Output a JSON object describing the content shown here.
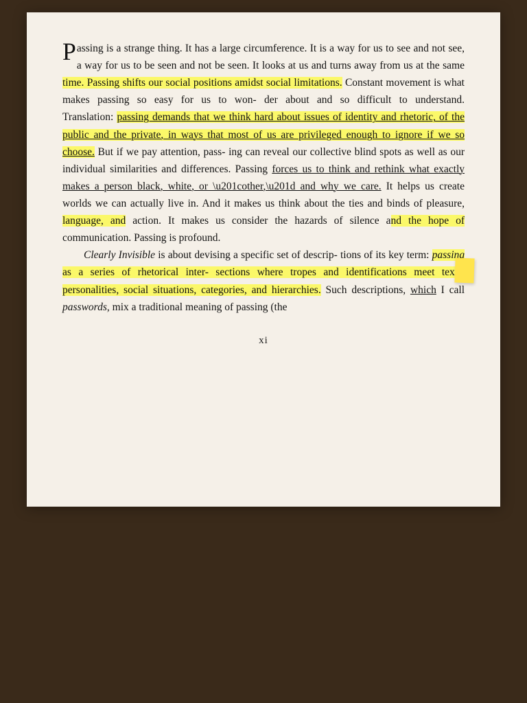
{
  "page": {
    "number": "xi",
    "background": "#f5f0e8"
  },
  "paragraphs": [
    {
      "id": "para1",
      "first_letter": "P",
      "text": "assing is a strange thing. It has a large circumference. It is a way for us to see and not see, a way for us to be seen and not be seen. It looks at us and turns away from us at the same time. Passing shifts our social positions amidst social limitations. Constant movement is what makes passing so easy for us to wonder about and so difficult to understand. Translation: passing demands that we think hard about issues of identity and rhetoric, of the public and the private, in ways that most of us are privileged enough to ignore if we so choose. But if we pay attention, passing can reveal our collective blind spots as well as our individual similarities and differences. Passing forces us to think and rethink what exactly makes a person black, white, or “other,” and why we care. It helps us create worlds we can actually live in. And it makes us think about the ties and binds of pleasure, language, and action. It makes us consider the hazards of silence and the hope of communication. Passing is profound."
    },
    {
      "id": "para2",
      "indent": true,
      "text": "Clearly Invisible is about devising a specific set of descriptions of its key term: passing as a series of rhetorical intersections where tropes and identifications meet texts, personalities, social situations, categories, and hierarchies. Such descriptions, which I call passwords, mix a traditional meaning of passing (the"
    }
  ],
  "sticky_note": {
    "color": "#ffe44d"
  }
}
